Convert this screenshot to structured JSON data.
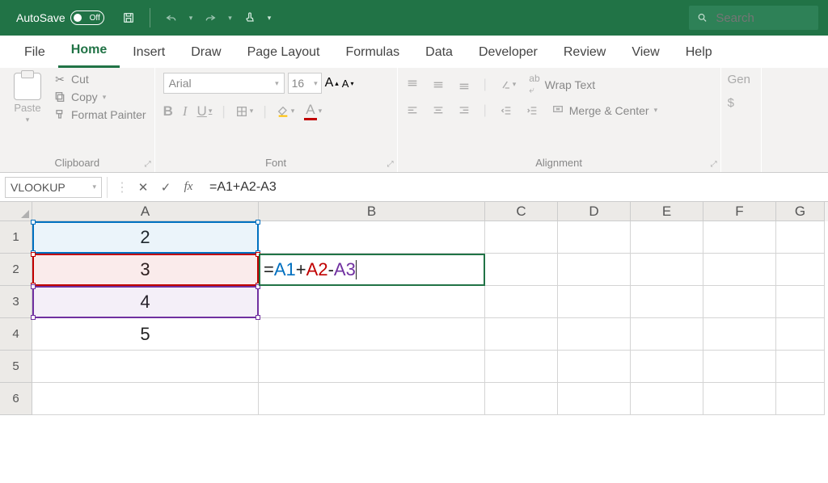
{
  "titlebar": {
    "autosave_label": "AutoSave",
    "autosave_state": "Off",
    "search_placeholder": "Search"
  },
  "tabs": [
    "File",
    "Home",
    "Insert",
    "Draw",
    "Page Layout",
    "Formulas",
    "Data",
    "Developer",
    "Review",
    "View",
    "Help"
  ],
  "active_tab": 1,
  "clipboard": {
    "paste": "Paste",
    "cut": "Cut",
    "copy": "Copy",
    "format_painter": "Format Painter",
    "group_label": "Clipboard"
  },
  "font": {
    "name": "Arial",
    "size": "16",
    "group_label": "Font"
  },
  "alignment": {
    "wrap_text": "Wrap Text",
    "merge_center": "Merge & Center",
    "group_label": "Alignment"
  },
  "number": {
    "label": "Gen"
  },
  "formulabar": {
    "namebox": "VLOOKUP",
    "formula": "=A1+A2-A3"
  },
  "columns": [
    "A",
    "B",
    "C",
    "D",
    "E",
    "F",
    "G"
  ],
  "rownums": [
    "1",
    "2",
    "3",
    "4",
    "5",
    "6"
  ],
  "cells": {
    "A1": "2",
    "A2": "3",
    "A3": "4",
    "A4": "5",
    "B2_refs": {
      "r1": "A1",
      "op1": "+",
      "r2": "A2",
      "op2": "-",
      "r3": "A3"
    }
  },
  "colors": {
    "accent": "#217346",
    "ref_blue": "#0070c0",
    "ref_red": "#c00000",
    "ref_purple": "#7030a0"
  }
}
